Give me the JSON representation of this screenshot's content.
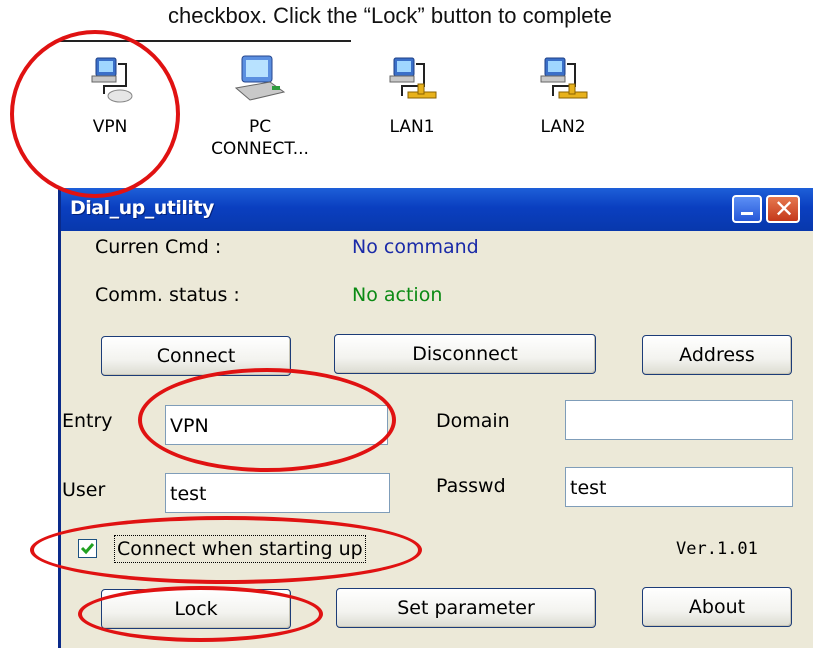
{
  "instruction": "checkbox. Click the “Lock” button to complete",
  "desktop_icons": [
    {
      "label": "VPN"
    },
    {
      "label": "PC CONNECT..."
    },
    {
      "label": "LAN1"
    },
    {
      "label": "LAN2"
    }
  ],
  "window": {
    "title": "Dial_up_utility",
    "close_glyph": "✕",
    "current_cmd_label": "Curren Cmd :",
    "current_cmd_value": "No command",
    "comm_status_label": "Comm. status :",
    "comm_status_value": "No action",
    "buttons": {
      "connect": "Connect",
      "disconnect": "Disconnect",
      "address": "Address",
      "lock": "Lock",
      "set_parameter": "Set parameter",
      "about": "About"
    },
    "fields": {
      "entry_label": "Entry",
      "entry_value": "VPN",
      "domain_label": "Domain",
      "domain_value": "",
      "user_label": "User",
      "user_value": "test",
      "passwd_label": "Passwd",
      "passwd_value": "test"
    },
    "checkbox": {
      "label": "Connect when starting up",
      "checked": true
    },
    "version": "Ver.1.01"
  },
  "colors": {
    "annotation": "#e01212",
    "status_blue": "#1a2aa8",
    "status_green": "#0b8a14",
    "titlebar": "#0a3fc0"
  }
}
